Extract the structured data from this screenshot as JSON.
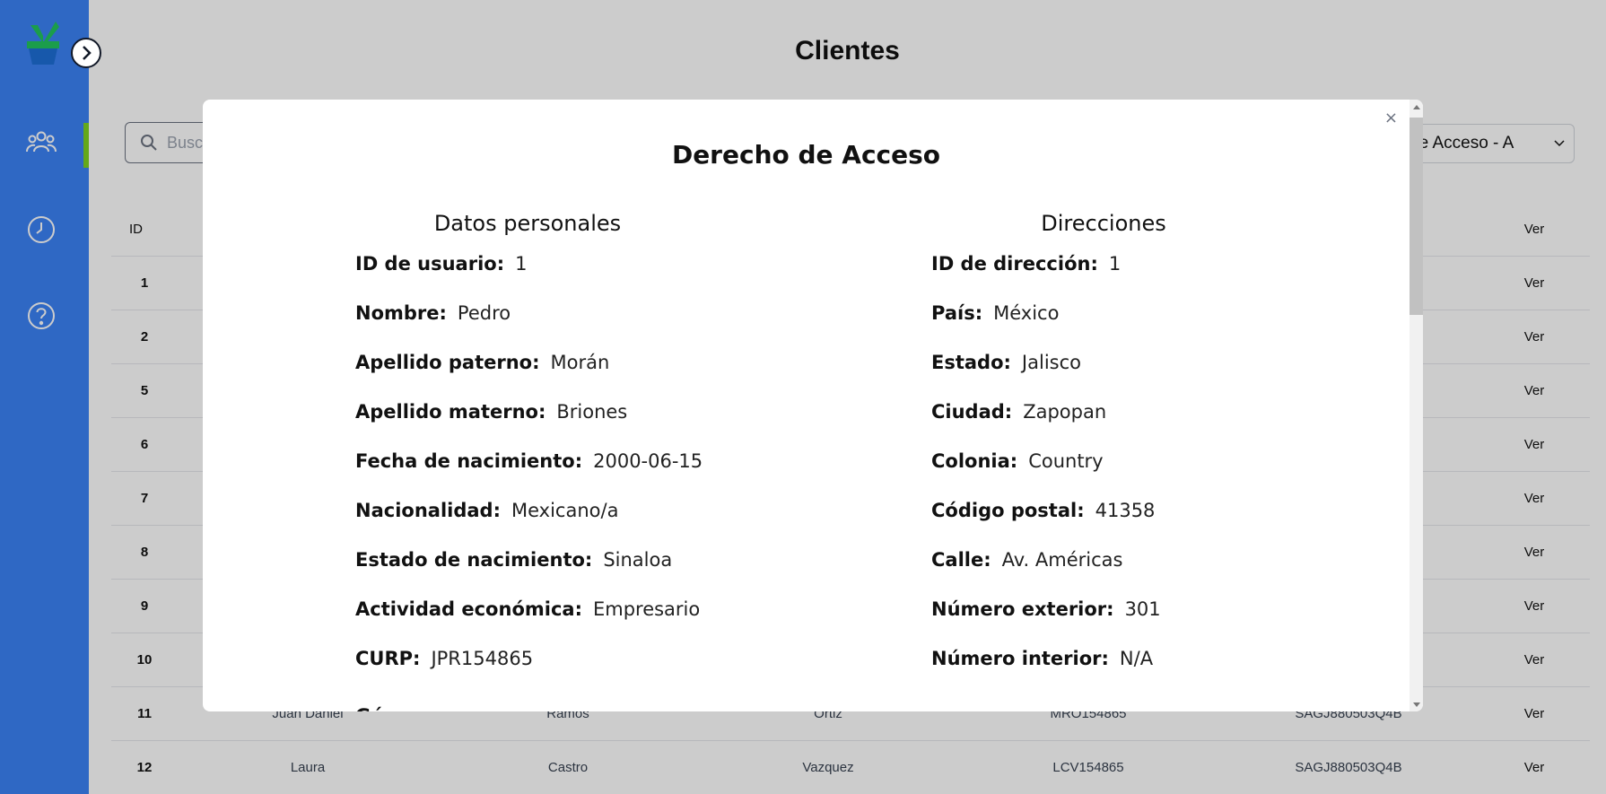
{
  "page": {
    "title": "Clientes"
  },
  "search": {
    "placeholder": "Buscar"
  },
  "sort": {
    "selected": "Derecho de Acceso - A"
  },
  "sidebar": {
    "items": [
      {
        "icon": "users-icon"
      },
      {
        "icon": "clock-icon"
      },
      {
        "icon": "help-icon"
      }
    ]
  },
  "table": {
    "headers": {
      "id": "ID",
      "ver": "Ver"
    },
    "rows": [
      {
        "id": "1",
        "nombre": "",
        "paterno": "",
        "materno": "",
        "curp": "",
        "rfc": "",
        "ver": "Ver"
      },
      {
        "id": "2",
        "nombre": "",
        "paterno": "",
        "materno": "",
        "curp": "",
        "rfc": "",
        "ver": "Ver"
      },
      {
        "id": "5",
        "nombre": "",
        "paterno": "",
        "materno": "",
        "curp": "",
        "rfc": "",
        "ver": "Ver"
      },
      {
        "id": "6",
        "nombre": "",
        "paterno": "",
        "materno": "",
        "curp": "",
        "rfc": "",
        "ver": "Ver"
      },
      {
        "id": "7",
        "nombre": "",
        "paterno": "",
        "materno": "",
        "curp": "",
        "rfc": "",
        "ver": "Ver"
      },
      {
        "id": "8",
        "nombre": "",
        "paterno": "",
        "materno": "",
        "curp": "",
        "rfc": "",
        "ver": "Ver"
      },
      {
        "id": "9",
        "nombre": "",
        "paterno": "",
        "materno": "",
        "curp": "",
        "rfc": "",
        "ver": "Ver"
      },
      {
        "id": "10",
        "nombre": "",
        "paterno": "",
        "materno": "",
        "curp": "",
        "rfc": "",
        "ver": "Ver"
      },
      {
        "id": "11",
        "nombre": "Juan Daniel",
        "paterno": "Ramos",
        "materno": "Ortiz",
        "curp": "MRO154865",
        "rfc": "SAGJ880503Q4B",
        "ver": "Ver"
      },
      {
        "id": "12",
        "nombre": "Laura",
        "paterno": "Castro",
        "materno": "Vazquez",
        "curp": "LCV154865",
        "rfc": "SAGJ880503Q4B",
        "ver": "Ver"
      }
    ]
  },
  "modal": {
    "close": "×",
    "title": "Derecho de Acceso",
    "personal": {
      "heading": "Datos personales",
      "fields": [
        {
          "label": "ID de usuario:",
          "value": "1"
        },
        {
          "label": "Nombre:",
          "value": "Pedro"
        },
        {
          "label": "Apellido paterno:",
          "value": "Morán"
        },
        {
          "label": "Apellido materno:",
          "value": "Briones"
        },
        {
          "label": "Fecha de nacimiento:",
          "value": "2000-06-15"
        },
        {
          "label": "Nacionalidad:",
          "value": "Mexicano/a"
        },
        {
          "label": "Estado de nacimiento:",
          "value": "Sinaloa"
        },
        {
          "label": "Actividad económica:",
          "value": "Empresario"
        },
        {
          "label": "CURP:",
          "value": "JPR154865"
        }
      ]
    },
    "addresses": {
      "heading": "Direcciones",
      "fields": [
        {
          "label": "ID de dirección:",
          "value": "1"
        },
        {
          "label": "País:",
          "value": "México"
        },
        {
          "label": "Estado:",
          "value": "Jalisco"
        },
        {
          "label": "Ciudad:",
          "value": "Zapopan"
        },
        {
          "label": "Colonia:",
          "value": "Country"
        },
        {
          "label": "Código postal:",
          "value": "41358"
        },
        {
          "label": "Calle:",
          "value": "Av. Américas"
        },
        {
          "label": "Número exterior:",
          "value": "301"
        },
        {
          "label": "Número interior:",
          "value": "N/A"
        }
      ]
    }
  },
  "colors": {
    "sidebar": "#3b82f6",
    "active_indicator": "#7ed321",
    "overlay": "rgba(0,0,0,0.2)"
  }
}
